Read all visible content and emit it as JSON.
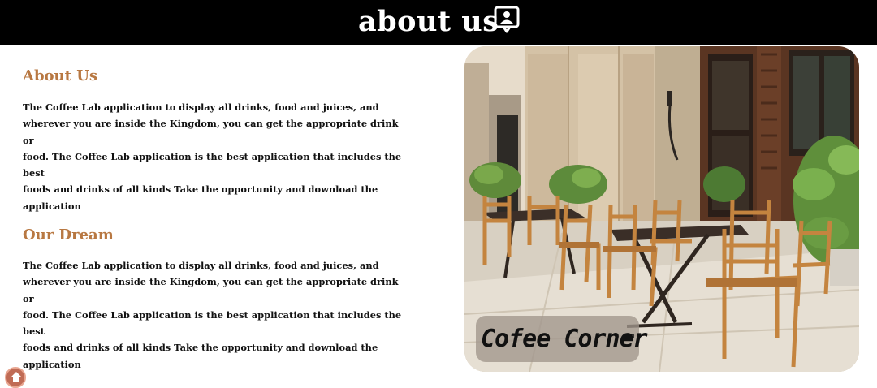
{
  "header": {
    "title": "about us",
    "icon": "user-badge-icon"
  },
  "sections": [
    {
      "heading": "About Us",
      "lines": [
        "The Coffee Lab application to display all drinks, food and juices, and",
        "wherever you are inside the Kingdom, you can get the appropriate drink or",
        "food. The Coffee Lab application is the best application that includes the best",
        "foods and drinks of all kinds Take the opportunity and download the",
        "application"
      ]
    },
    {
      "heading": "Our Dream",
      "lines": [
        "The Coffee Lab application to display all drinks, food and juices, and",
        "wherever you are inside the Kingdom, you can get the appropriate drink or",
        "food. The Coffee Lab application is the best application that includes the best",
        "foods and drinks of all kinds Take the opportunity and download the",
        "application"
      ]
    }
  ],
  "photo": {
    "subject": "cafe-terrace-photo",
    "badge_text": "Cofee Corner",
    "badge_icon": "coffee-cup-icon"
  },
  "floating_button": {
    "icon": "home-icon"
  },
  "colors": {
    "header_bg": "#000000",
    "header_text": "#ffffff",
    "heading_accent": "#b87842",
    "body_text": "#111111",
    "fab_bg": "#c06b55"
  }
}
